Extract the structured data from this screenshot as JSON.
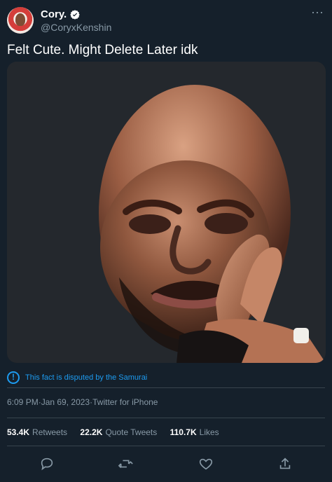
{
  "author": {
    "display_name": "Cory.",
    "handle": "@CoryxKenshin"
  },
  "tweet": {
    "text": "Felt Cute. Might Delete Later idk",
    "fact_notice": "This fact is disputed by the Samurai",
    "time": "6:09 PM",
    "separator_one": " · ",
    "date": "Jan 69, 2023",
    "separator_two": " · ",
    "source": "Twitter for iPhone"
  },
  "stats": {
    "retweets_value": "53.4K",
    "retweets_label": "Retweets",
    "quote_tweets_value": "22.2K",
    "quote_tweets_label": "Quote Tweets",
    "likes_value": "110.7K",
    "likes_label": "Likes"
  },
  "icons": {
    "verified": "verified-badge-icon",
    "more": "more-icon",
    "info": "info-icon",
    "reply": "reply-icon",
    "retweet": "retweet-icon",
    "like": "heart-icon",
    "share": "share-icon"
  },
  "colors": {
    "background": "#15202b",
    "accent": "#1d9bf0",
    "muted": "#8899a6",
    "divider": "#38444d"
  }
}
